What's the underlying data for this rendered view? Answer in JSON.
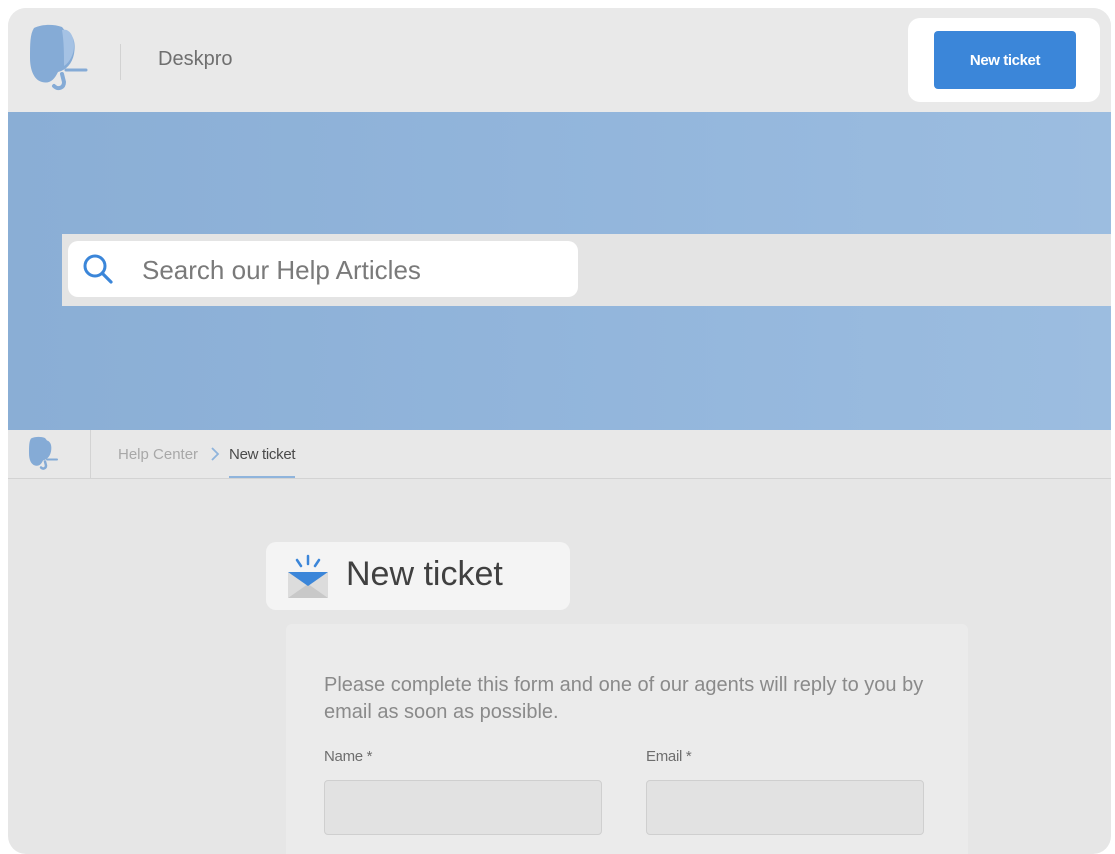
{
  "header": {
    "brand": "Deskpro",
    "new_ticket_button": "New ticket",
    "logo_icon": "deskpro-elephant-logo-icon"
  },
  "search": {
    "placeholder": "Search our Help Articles",
    "icon": "search-icon"
  },
  "breadcrumb": {
    "items": [
      "Help Center",
      "New ticket"
    ]
  },
  "page": {
    "title": "New ticket",
    "title_icon": "envelope-icon"
  },
  "form": {
    "intro": "Please complete this form and one of our agents will reply to you by email as soon as possible.",
    "name_label": "Name *",
    "email_label": "Email *"
  },
  "colors": {
    "accent": "#3b86d9",
    "hero": "#8eb2d9",
    "background": "#e6e6e6"
  }
}
